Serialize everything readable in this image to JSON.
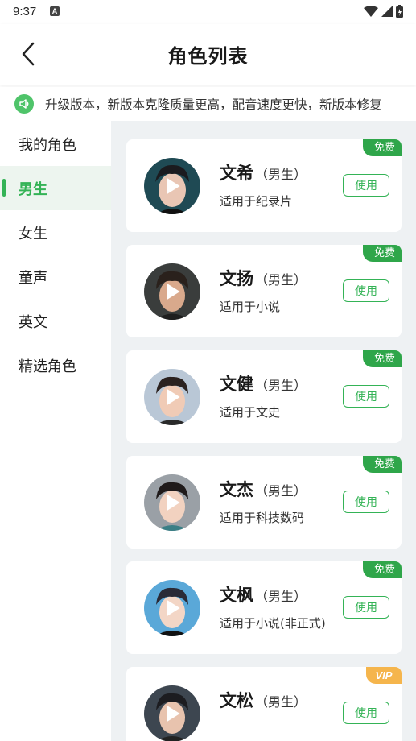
{
  "status_bar": {
    "time": "9:37",
    "indicator": "A"
  },
  "header": {
    "title": "角色列表",
    "back_icon": "chevron-left-icon"
  },
  "notice": {
    "icon": "speaker-icon",
    "text": "升级版本，新版本克隆质量更高，配音速度更快，新版本修复"
  },
  "sidebar": {
    "items": [
      {
        "label": "我的角色"
      },
      {
        "label": "男生",
        "active": true
      },
      {
        "label": "女生"
      },
      {
        "label": "童声"
      },
      {
        "label": "英文"
      },
      {
        "label": "精选角色"
      }
    ]
  },
  "colors": {
    "accent": "#34b356",
    "free_badge": "#2fa64a",
    "vip_badge": "#f5b54c",
    "list_bg": "#eef1f3"
  },
  "voices": [
    {
      "name": "文希",
      "gender": "（男生）",
      "desc": "适用于纪录片",
      "badge": "免费",
      "use_label": "使用"
    },
    {
      "name": "文扬",
      "gender": "（男生）",
      "desc": "适用于小说",
      "badge": "免费",
      "use_label": "使用"
    },
    {
      "name": "文健",
      "gender": "（男生）",
      "desc": "适用于文史",
      "badge": "免费",
      "use_label": "使用"
    },
    {
      "name": "文杰",
      "gender": "（男生）",
      "desc": "适用于科技数码",
      "badge": "免费",
      "use_label": "使用"
    },
    {
      "name": "文枫",
      "gender": "（男生）",
      "desc": "适用于小说(非正式)",
      "badge": "免费",
      "use_label": "使用"
    },
    {
      "name": "文松",
      "gender": "（男生）",
      "desc": "",
      "badge": "VIP",
      "use_label": "使用"
    }
  ]
}
